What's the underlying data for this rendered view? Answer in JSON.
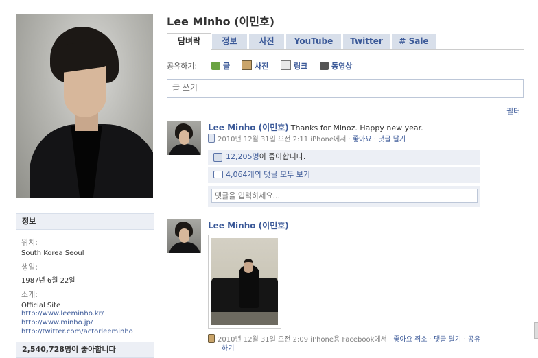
{
  "profile": {
    "name": "Lee Minho (이민호)"
  },
  "tabs": [
    "담벼락",
    "정보",
    "사진",
    "YouTube",
    "Twitter",
    "# Sale"
  ],
  "share": {
    "label": "공유하기:",
    "items": [
      "글",
      "사진",
      "링크",
      "동영상"
    ]
  },
  "composer": {
    "placeholder": "글 쓰기"
  },
  "filter_label": "필터",
  "info": {
    "header": "정보",
    "location_label": "위치:",
    "location": "South Korea Seoul",
    "birthday_label": "생일:",
    "birthday": "1987년 6월 22일",
    "about_label": "소개:",
    "about_title": "Official Site",
    "links": [
      "http://www.leeminho.kr/",
      "http://www.minho.jp/",
      "http://twitter.com/actorleeminho"
    ]
  },
  "likes_count": "2,540,728명이 좋아합니다",
  "posts": [
    {
      "author": "Lee Minho (이민호)",
      "text": "Thanks for Minoz. Happy new year.",
      "date": "2010년 12월 31일 오전 2:11",
      "via": "iPhone에서",
      "dot": "·",
      "like": "좋아요",
      "comment": "댓글 달기",
      "like_count": "12,205명",
      "like_suffix": "이 좋아합니다.",
      "view_comments": "4,064개의 댓글 모두 보기",
      "comment_placeholder": "댓글을 입력하세요..."
    },
    {
      "author": "Lee Minho (이민호)",
      "date": "2010년 12월 31일 오전 2:09",
      "via": "iPhone용 Facebook에서",
      "dot": "·",
      "unlike": "좋아요 취소",
      "comment": "댓글 달기",
      "share": "공유",
      "share_suffix": "하기"
    }
  ],
  "colors": {
    "link": "#3b5998",
    "tab_bg": "#d8dfea",
    "box_bg": "#eceff5"
  }
}
